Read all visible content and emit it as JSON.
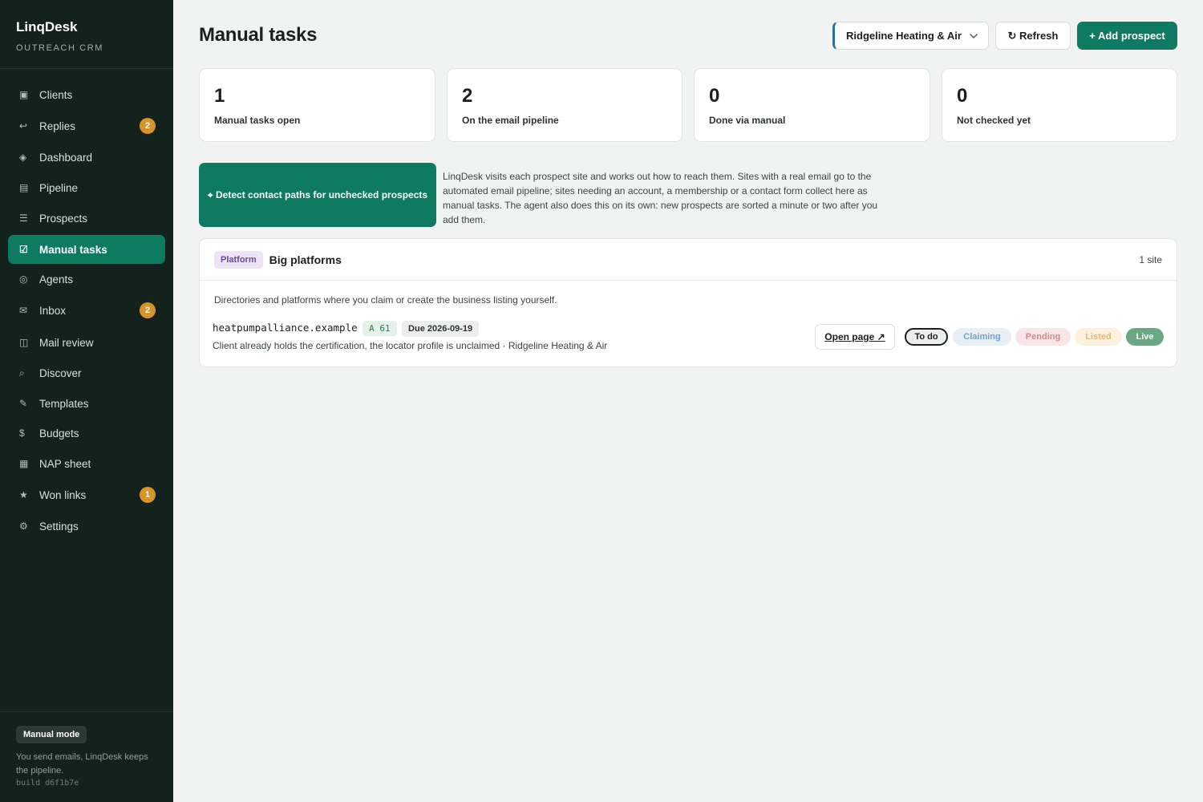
{
  "app": {
    "name": "LinqDesk",
    "subtitle": "OUTREACH CRM"
  },
  "sidebar": {
    "items": [
      {
        "label": "Clients",
        "icon": "▣",
        "badge": null
      },
      {
        "label": "Replies",
        "icon": "↩",
        "badge": "2"
      },
      {
        "label": "Dashboard",
        "icon": "◈",
        "badge": null
      },
      {
        "label": "Pipeline",
        "icon": "▤",
        "badge": null
      },
      {
        "label": "Prospects",
        "icon": "☰",
        "badge": null
      },
      {
        "label": "Manual tasks",
        "icon": "☑",
        "badge": null,
        "active": true
      },
      {
        "label": "Agents",
        "icon": "◎",
        "badge": null
      },
      {
        "label": "Inbox",
        "icon": "✉",
        "badge": "2"
      },
      {
        "label": "Mail review",
        "icon": "◫",
        "badge": null
      },
      {
        "label": "Discover",
        "icon": "⌕",
        "badge": null
      },
      {
        "label": "Templates",
        "icon": "✎",
        "badge": null
      },
      {
        "label": "Budgets",
        "icon": "$",
        "badge": null
      },
      {
        "label": "NAP sheet",
        "icon": "▦",
        "badge": null
      },
      {
        "label": "Won links",
        "icon": "★",
        "badge": "1"
      },
      {
        "label": "Settings",
        "icon": "⚙",
        "badge": null
      }
    ],
    "footer": {
      "mode": "Manual mode",
      "text": "You send emails, LinqDesk keeps the pipeline.",
      "build": "build d6f1b7e"
    }
  },
  "header": {
    "title": "Manual tasks",
    "client_select": "Ridgeline Heating & Air",
    "refresh_label": "↻ Refresh",
    "add_label": "+ Add prospect"
  },
  "stats": [
    {
      "value": "1",
      "label": "Manual tasks open"
    },
    {
      "value": "2",
      "label": "On the email pipeline"
    },
    {
      "value": "0",
      "label": "Done via manual"
    },
    {
      "value": "0",
      "label": "Not checked yet"
    }
  ],
  "detect": {
    "button_label": "⌖ Detect contact paths for unchecked prospects",
    "description": "LinqDesk visits each prospect site and works out how to reach them. Sites with a real email go to the automated email pipeline; sites needing an account, a membership or a contact form collect here as manual tasks. The agent also does this on its own: new prospects are sorted a minute or two after you add them."
  },
  "group": {
    "tag": "Platform",
    "title": "Big platforms",
    "count": "1 site",
    "description": "Directories and platforms where you claim or create the business listing yourself.",
    "sites": [
      {
        "domain": "heatpumpalliance.example",
        "score": "A 61",
        "due": "Due 2026-09-19",
        "note": "Client already holds the certification, the locator profile is unclaimed · Ridgeline Heating & Air",
        "open_label": "Open page ↗",
        "statuses": [
          "To do",
          "Claiming",
          "Pending",
          "Listed",
          "Live"
        ],
        "current_status": "To do"
      }
    ]
  },
  "colors": {
    "sidebar_bg": "#14221d",
    "accent": "#0f7a62",
    "badge": "#d8942a",
    "page_bg": "#f1f3f2"
  }
}
